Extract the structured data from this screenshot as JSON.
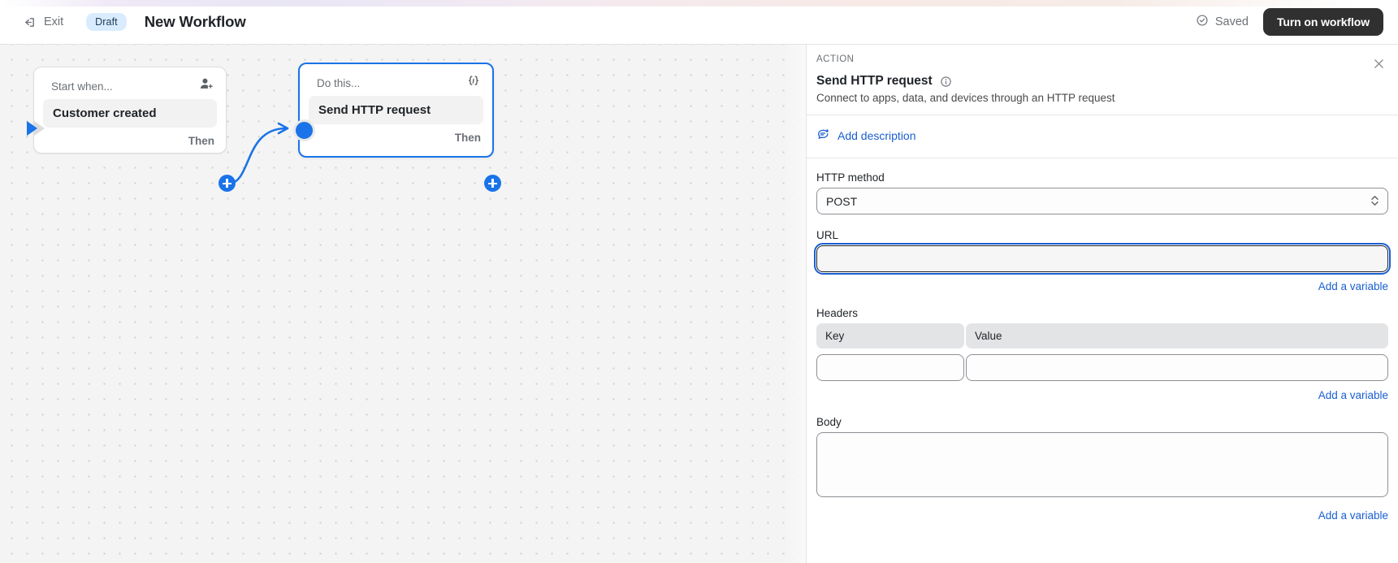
{
  "topbar": {
    "exit_label": "Exit",
    "status_badge": "Draft",
    "workflow_title": "New Workflow",
    "saved_label": "Saved",
    "turn_on_label": "Turn on workflow"
  },
  "canvas": {
    "nodes": [
      {
        "head_label": "Start when...",
        "chip_label": "Customer created",
        "then_label": "Then",
        "icon": "add-customer-icon"
      },
      {
        "head_label": "Do this...",
        "chip_label": "Send HTTP request",
        "then_label": "Then",
        "icon": "code-braces-icon"
      }
    ]
  },
  "panel": {
    "eyebrow": "ACTION",
    "title": "Send HTTP request",
    "subtitle": "Connect to apps, data, and devices through an HTTP request",
    "add_description_label": "Add description",
    "http_method": {
      "label": "HTTP method",
      "value": "POST"
    },
    "url": {
      "label": "URL",
      "value": "",
      "add_variable_label": "Add a variable"
    },
    "headers": {
      "label": "Headers",
      "col_key": "Key",
      "col_value": "Value",
      "key_value": "",
      "value_value": "",
      "add_variable_label": "Add a variable"
    },
    "body": {
      "label": "Body",
      "value": "",
      "add_variable_label": "Add a variable"
    }
  },
  "colors": {
    "accent_blue": "#1a73e8",
    "link_blue": "#1a5fd0",
    "badge_bg": "#d9ecff",
    "dark_button": "#303030"
  }
}
